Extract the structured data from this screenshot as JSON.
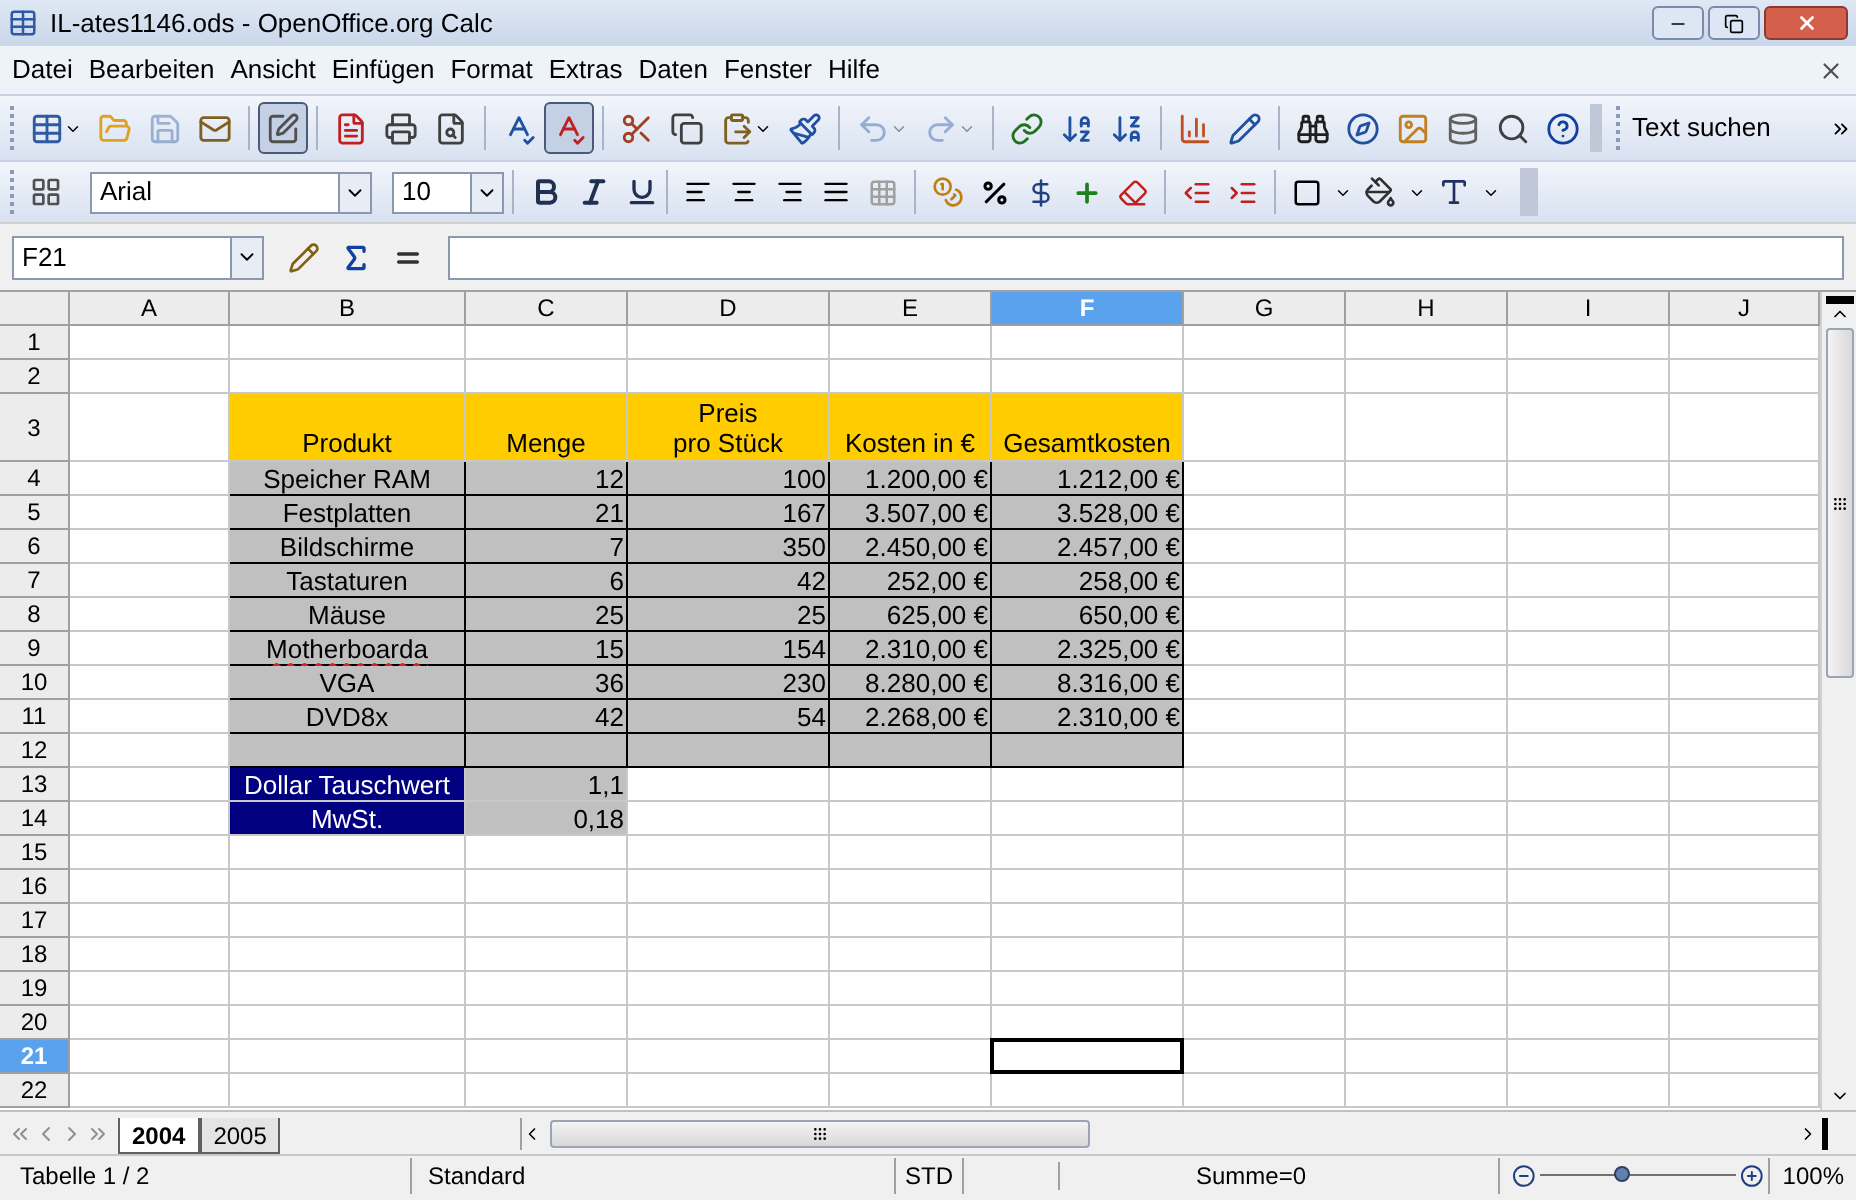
{
  "window": {
    "title": "IL-ates1146.ods - OpenOffice.org Calc"
  },
  "menu": [
    "Datei",
    "Bearbeiten",
    "Ansicht",
    "Einfügen",
    "Format",
    "Extras",
    "Daten",
    "Fenster",
    "Hilfe"
  ],
  "toolbar": {
    "buttons": [
      {
        "kind": "new",
        "disabled": false,
        "pressed": false
      },
      {
        "kind": "open",
        "disabled": false,
        "pressed": false
      },
      {
        "kind": "save",
        "disabled": true,
        "pressed": false
      },
      {
        "kind": "mail",
        "disabled": false,
        "pressed": false
      },
      {
        "kind": "edit",
        "disabled": false,
        "pressed": true
      },
      {
        "kind": "pdf",
        "disabled": false,
        "pressed": false
      },
      {
        "kind": "print",
        "disabled": false,
        "pressed": false
      },
      {
        "kind": "preview",
        "disabled": false,
        "pressed": false
      },
      {
        "kind": "spellcheck",
        "disabled": false,
        "pressed": false
      },
      {
        "kind": "autospell",
        "disabled": false,
        "pressed": true
      },
      {
        "kind": "cut",
        "disabled": false,
        "pressed": false
      },
      {
        "kind": "copy",
        "disabled": false,
        "pressed": false
      },
      {
        "kind": "paste",
        "disabled": false,
        "pressed": false
      },
      {
        "kind": "brush",
        "disabled": false,
        "pressed": false
      },
      {
        "kind": "undo",
        "disabled": true,
        "pressed": false
      },
      {
        "kind": "redo",
        "disabled": true,
        "pressed": false
      },
      {
        "kind": "link",
        "disabled": false,
        "pressed": false
      },
      {
        "kind": "sortup",
        "disabled": false,
        "pressed": false
      },
      {
        "kind": "sortdown",
        "disabled": false,
        "pressed": false
      },
      {
        "kind": "chart",
        "disabled": false,
        "pressed": false
      },
      {
        "kind": "draw",
        "disabled": false,
        "pressed": false
      },
      {
        "kind": "find",
        "disabled": false,
        "pressed": false
      },
      {
        "kind": "navigator",
        "disabled": false,
        "pressed": false
      },
      {
        "kind": "gallery",
        "disabled": false,
        "pressed": false
      },
      {
        "kind": "database",
        "disabled": false,
        "pressed": false
      },
      {
        "kind": "zoom",
        "disabled": false,
        "pressed": false
      },
      {
        "kind": "help",
        "disabled": false,
        "pressed": false
      }
    ],
    "search_label": "Text suchen"
  },
  "format_bar": {
    "font": "Arial",
    "size": "10"
  },
  "formula_bar": {
    "name_box": "F21"
  },
  "columns": [
    {
      "label": "A",
      "selected": false
    },
    {
      "label": "B",
      "selected": false
    },
    {
      "label": "C",
      "selected": false
    },
    {
      "label": "D",
      "selected": false
    },
    {
      "label": "E",
      "selected": false
    },
    {
      "label": "F",
      "selected": true
    },
    {
      "label": "G",
      "selected": false
    },
    {
      "label": "H",
      "selected": false
    },
    {
      "label": "I",
      "selected": false
    },
    {
      "label": "J",
      "selected": false
    }
  ],
  "rows": [
    {
      "label": "1",
      "selected": false
    },
    {
      "label": "2",
      "selected": false
    },
    {
      "label": "3",
      "selected": false,
      "cells": [
        {
          "kind": "empty",
          "selected": false
        },
        {
          "kind": "header",
          "text": "Produkt",
          "selected": false
        },
        {
          "kind": "header",
          "text": "Menge",
          "selected": false
        },
        {
          "kind": "header",
          "text": "Preis\npro Stück",
          "selected": false
        },
        {
          "kind": "header",
          "text": "Kosten in €",
          "selected": false
        },
        {
          "kind": "header",
          "text": "Gesamtkosten",
          "selected": false
        }
      ]
    },
    {
      "label": "4",
      "selected": false,
      "cells": [
        {
          "kind": "empty",
          "selected": false
        },
        {
          "kind": "product",
          "text": "Speicher RAM",
          "misspelled": false,
          "selected": false
        },
        {
          "kind": "number",
          "text": "12",
          "selected": false
        },
        {
          "kind": "number",
          "text": "100",
          "selected": false
        },
        {
          "kind": "number",
          "text": "1.200,00 €",
          "selected": false
        },
        {
          "kind": "number",
          "text": "1.212,00 €",
          "selected": false
        }
      ]
    },
    {
      "label": "5",
      "selected": false,
      "cells": [
        {
          "kind": "empty",
          "selected": false
        },
        {
          "kind": "product",
          "text": "Festplatten",
          "misspelled": false,
          "selected": false
        },
        {
          "kind": "number",
          "text": "21",
          "selected": false
        },
        {
          "kind": "number",
          "text": "167",
          "selected": false
        },
        {
          "kind": "number",
          "text": "3.507,00 €",
          "selected": false
        },
        {
          "kind": "number",
          "text": "3.528,00 €",
          "selected": false
        }
      ]
    },
    {
      "label": "6",
      "selected": false,
      "cells": [
        {
          "kind": "empty",
          "selected": false
        },
        {
          "kind": "product",
          "text": "Bildschirme",
          "misspelled": false,
          "selected": false
        },
        {
          "kind": "number",
          "text": "7",
          "selected": false
        },
        {
          "kind": "number",
          "text": "350",
          "selected": false
        },
        {
          "kind": "number",
          "text": "2.450,00 €",
          "selected": false
        },
        {
          "kind": "number",
          "text": "2.457,00 €",
          "selected": false
        }
      ]
    },
    {
      "label": "7",
      "selected": false,
      "cells": [
        {
          "kind": "empty",
          "selected": false
        },
        {
          "kind": "product",
          "text": "Tastaturen",
          "misspelled": false,
          "selected": false
        },
        {
          "kind": "number",
          "text": "6",
          "selected": false
        },
        {
          "kind": "number",
          "text": "42",
          "selected": false
        },
        {
          "kind": "number",
          "text": "252,00 €",
          "selected": false
        },
        {
          "kind": "number",
          "text": "258,00 €",
          "selected": false
        }
      ]
    },
    {
      "label": "8",
      "selected": false,
      "cells": [
        {
          "kind": "empty",
          "selected": false
        },
        {
          "kind": "product",
          "text": "Mäuse",
          "misspelled": false,
          "selected": false
        },
        {
          "kind": "number",
          "text": "25",
          "selected": false
        },
        {
          "kind": "number",
          "text": "25",
          "selected": false
        },
        {
          "kind": "number",
          "text": "625,00 €",
          "selected": false
        },
        {
          "kind": "number",
          "text": "650,00 €",
          "selected": false
        }
      ]
    },
    {
      "label": "9",
      "selected": false,
      "cells": [
        {
          "kind": "empty",
          "selected": false
        },
        {
          "kind": "product",
          "text": "Motherboarda",
          "misspelled": true,
          "selected": false
        },
        {
          "kind": "number",
          "text": "15",
          "selected": false
        },
        {
          "kind": "number",
          "text": "154",
          "selected": false
        },
        {
          "kind": "number",
          "text": "2.310,00 €",
          "selected": false
        },
        {
          "kind": "number",
          "text": "2.325,00 €",
          "selected": false
        }
      ]
    },
    {
      "label": "10",
      "selected": false,
      "cells": [
        {
          "kind": "empty",
          "selected": false
        },
        {
          "kind": "product",
          "text": "VGA",
          "misspelled": false,
          "selected": false
        },
        {
          "kind": "number",
          "text": "36",
          "selected": false
        },
        {
          "kind": "number",
          "text": "230",
          "selected": false
        },
        {
          "kind": "number",
          "text": "8.280,00 €",
          "selected": false
        },
        {
          "kind": "number",
          "text": "8.316,00 €",
          "selected": false
        }
      ]
    },
    {
      "label": "11",
      "selected": false,
      "cells": [
        {
          "kind": "empty",
          "selected": false
        },
        {
          "kind": "product",
          "text": "DVD8x",
          "misspelled": false,
          "selected": false
        },
        {
          "kind": "number",
          "text": "42",
          "selected": false
        },
        {
          "kind": "number",
          "text": "54",
          "selected": false
        },
        {
          "kind": "number",
          "text": "2.268,00 €",
          "selected": false
        },
        {
          "kind": "number",
          "text": "2.310,00 €",
          "selected": false
        }
      ]
    },
    {
      "label": "12",
      "selected": false,
      "cells": [
        {
          "kind": "empty",
          "selected": false
        },
        {
          "kind": "blank",
          "selected": false
        },
        {
          "kind": "blank",
          "selected": false
        },
        {
          "kind": "blank",
          "selected": false
        },
        {
          "kind": "blank",
          "selected": false
        },
        {
          "kind": "blank",
          "selected": false
        }
      ]
    },
    {
      "label": "13",
      "selected": false,
      "cells": [
        {
          "kind": "empty",
          "selected": false
        },
        {
          "kind": "label",
          "text": "Dollar Tauschwert",
          "selected": false
        },
        {
          "kind": "value",
          "text": "1,1",
          "selected": false
        }
      ]
    },
    {
      "label": "14",
      "selected": false,
      "cells": [
        {
          "kind": "empty",
          "selected": false
        },
        {
          "kind": "label",
          "text": "MwSt.",
          "selected": false
        },
        {
          "kind": "value",
          "text": "0,18",
          "selected": false
        }
      ]
    },
    {
      "label": "15",
      "selected": false
    },
    {
      "label": "16",
      "selected": false
    },
    {
      "label": "17",
      "selected": false
    },
    {
      "label": "18",
      "selected": false
    },
    {
      "label": "19",
      "selected": false
    },
    {
      "label": "20",
      "selected": false
    },
    {
      "label": "21",
      "selected": true,
      "cells": [
        {
          "kind": "empty",
          "selected": false
        },
        {
          "kind": "empty",
          "selected": false
        },
        {
          "kind": "empty",
          "selected": false
        },
        {
          "kind": "empty",
          "selected": false
        },
        {
          "kind": "empty",
          "selected": false
        },
        {
          "kind": "empty",
          "selected": true
        }
      ]
    },
    {
      "label": "22",
      "selected": false
    }
  ],
  "sheet_tabs": [
    {
      "label": "2004",
      "selected": true
    },
    {
      "label": "2005",
      "selected": false
    }
  ],
  "status_bar": {
    "sheet": "Tabelle 1 / 2",
    "style": "Standard",
    "mode": "STD",
    "sum": "Summe=0",
    "zoom": {
      "level": 0.42,
      "reading": "100%"
    }
  }
}
